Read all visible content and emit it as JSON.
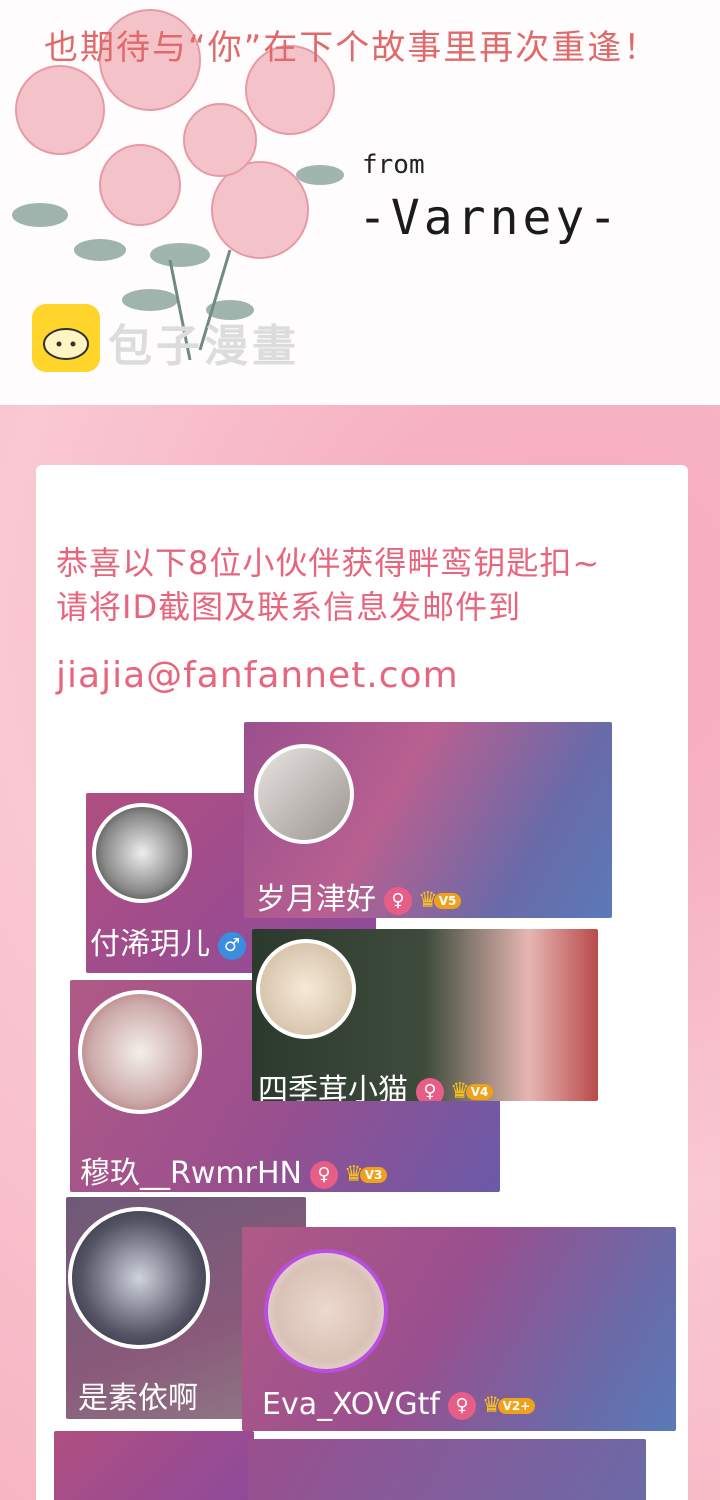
{
  "note": {
    "message": "也期待与“你”在下个故事里再次重逢！",
    "from_label": "from",
    "author": "-Varney-"
  },
  "watermark": {
    "text": "包子漫畫",
    "icon": "bun-logo-icon",
    "color": "#ffd52b"
  },
  "announcement": {
    "line1": "恭喜以下8位小伙伴获得畔鸾钥匙扣~",
    "line2": "请将ID截图及联系信息发邮件到",
    "email": "jiajia@fanfannet.com"
  },
  "winners": [
    {
      "name": "岁月津好",
      "gender": "female",
      "level": "V5"
    },
    {
      "name": "付浠玥儿",
      "gender": "male",
      "level": ""
    },
    {
      "name": "四季茸小猫",
      "gender": "female",
      "level": "V4"
    },
    {
      "name": "穆玖__RwmrHN",
      "gender": "female",
      "level": "V3"
    },
    {
      "name": "是素依啊",
      "gender": "",
      "level": ""
    },
    {
      "name": "Eva_XOVGtf",
      "gender": "female",
      "level": "V2+"
    }
  ],
  "icons": {
    "female": "♀",
    "male": "♂",
    "crown": "♛"
  },
  "colors": {
    "accent": "#e7657d",
    "note": "#e06a6a",
    "card_purple": "#9a4f8e",
    "card_blue": "#5a7ab8"
  }
}
